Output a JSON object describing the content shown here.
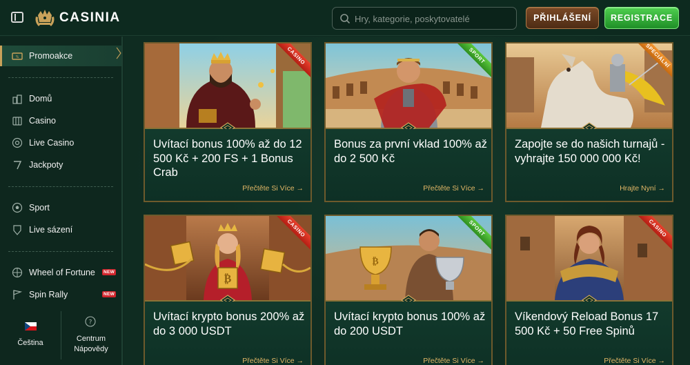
{
  "header": {
    "brand": "CASINIA",
    "search_placeholder": "Hry, kategorie, poskytovatelé",
    "login_label": "PŘIHLÁŠENÍ",
    "register_label": "REGISTRACE"
  },
  "sidebar": {
    "items": [
      {
        "label": "Promoakce",
        "icon": "promo-icon",
        "active": true
      },
      {
        "label": "Domů",
        "icon": "home-icon"
      },
      {
        "label": "Casino",
        "icon": "casino-icon"
      },
      {
        "label": "Live Casino",
        "icon": "live-casino-icon"
      },
      {
        "label": "Jackpoty",
        "icon": "jackpot-icon"
      },
      {
        "label": "Sport",
        "icon": "sport-icon"
      },
      {
        "label": "Live sázení",
        "icon": "live-betting-icon"
      },
      {
        "label": "Wheel of Fortune",
        "icon": "wheel-icon",
        "badge": "NEW"
      },
      {
        "label": "Spin Rally",
        "icon": "flag-icon",
        "badge": "NEW"
      }
    ],
    "language_label": "Čeština",
    "help_label_line1": "Centrum",
    "help_label_line2": "Nápovědy"
  },
  "promos": [
    {
      "ribbon": "CASINO",
      "title": "Uvítací bonus 100% až do 12 500 Kč + 200 FS + 1 Bonus Crab",
      "link": "Přečtěte Si Více →"
    },
    {
      "ribbon": "SPORT",
      "title": "Bonus za první vklad 100% až do 2 500 Kč",
      "link": "Přečtěte Si Více →"
    },
    {
      "ribbon": "SPECIÁLNÍ",
      "title": "Zapojte se do našich turnajů - vyhrajte 150 000 000 Kč!",
      "link": "Hrajte Nyní →"
    },
    {
      "ribbon": "CASINO",
      "title": "Uvítací krypto bonus 200% až do 3 000 USDT",
      "link": "Přečtěte Si Více →"
    },
    {
      "ribbon": "SPORT",
      "title": "Uvítací krypto bonus 100% až do 200 USDT",
      "link": "Přečtěte Si Více →"
    },
    {
      "ribbon": "CASINO",
      "title": "Víkendový Reload Bonus 17 500 Kč + 50 Free Spinů",
      "link": "Přečtěte Si Více →"
    }
  ],
  "colors": {
    "background": "#0f2a20",
    "gold": "#c9a25a",
    "link": "#e3b766",
    "register_green": "#2fa83a",
    "login_brown": "#6a3f20",
    "ribbon_casino": "#d8301f",
    "ribbon_sport": "#44ab2e",
    "ribbon_special": "#e0821f"
  }
}
